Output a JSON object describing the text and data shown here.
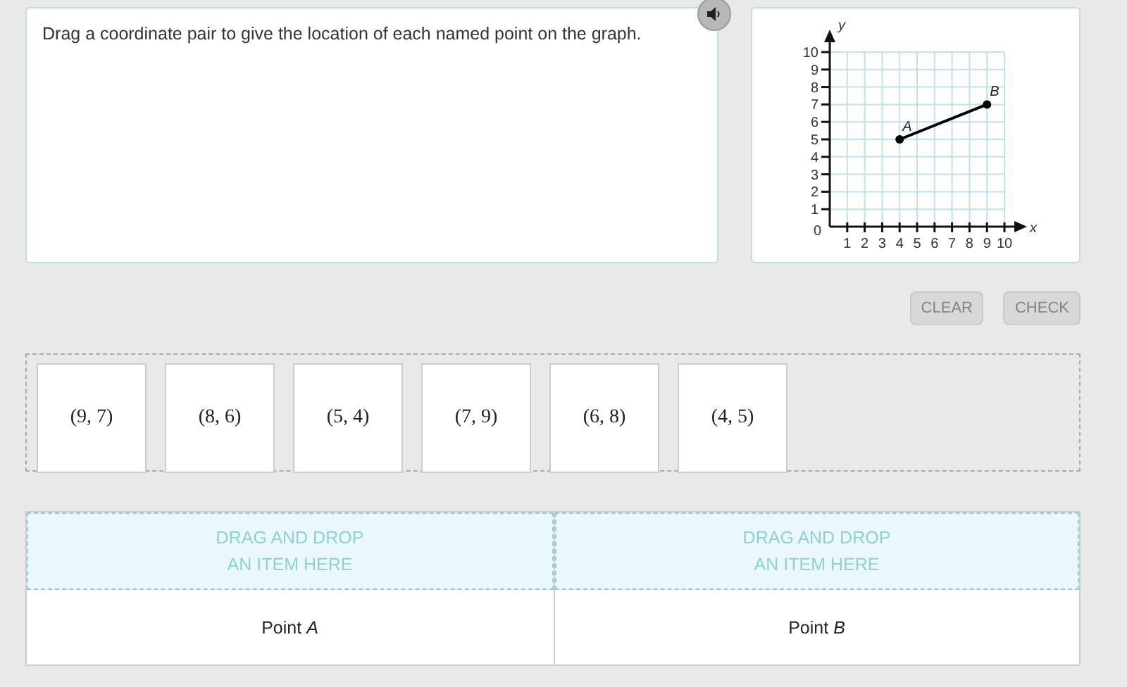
{
  "question": {
    "text": "Drag a coordinate pair to give the location of each named point on the graph."
  },
  "audio_button": {
    "muted": false
  },
  "graph": {
    "chart_data": {
      "type": "line",
      "xlabel": "x",
      "ylabel": "y",
      "x": [
        4,
        9
      ],
      "grid": true,
      "series": [
        {
          "color": "#000000",
          "marker": "circle",
          "values": [
            5,
            7
          ]
        }
      ],
      "xlim": [
        0,
        10
      ],
      "ylim": [
        0,
        10
      ],
      "xticks": [
        1,
        2,
        3,
        4,
        5,
        6,
        7,
        8,
        9,
        10
      ],
      "yticks": [
        1,
        2,
        3,
        4,
        5,
        6,
        7,
        8,
        9,
        10
      ],
      "annotations": [
        {
          "x": 4,
          "y": 5,
          "text": "A"
        },
        {
          "x": 9,
          "y": 7,
          "text": "B"
        }
      ]
    },
    "origin_label": "0"
  },
  "buttons": [
    {
      "label": "CLEAR",
      "disabled": true
    },
    {
      "label": "CHECK",
      "disabled": true
    }
  ],
  "items": [
    "(9, 7)",
    "(8, 6)",
    "(5, 4)",
    "(7, 9)",
    "(6, 8)",
    "(4, 5)"
  ],
  "drop_targets": [
    {
      "placeholder": "DRAG AND DROP\nAN ITEM HERE",
      "label": "Point *A*"
    },
    {
      "placeholder": "DRAG AND DROP\nAN ITEM HERE",
      "label": "Point *B*"
    }
  ]
}
